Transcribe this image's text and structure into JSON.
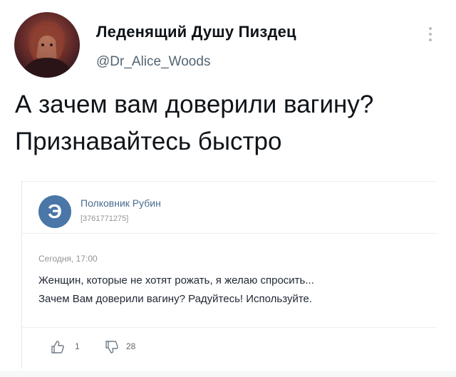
{
  "tweet": {
    "display_name": "Леденящий Душу Пиздец",
    "handle": "@Dr_Alice_Woods",
    "text_lines": [
      "А зачем вам доверили вагину?",
      "Признавайтесь быстро"
    ]
  },
  "embedded_post": {
    "avatar_letter": "Э",
    "author": "Полковник Рубин",
    "id": "[3761771275]",
    "date": "Сегодня, 17:00",
    "text_lines": [
      "Женщин, которые не хотят рожать, я желаю спросить...",
      "Зачем Вам доверили вагину? Радуйтесь! Используйте."
    ],
    "likes": "1",
    "dislikes": "28"
  },
  "icons": {
    "more": "more-vertical-icon",
    "like": "thumbs-up-icon",
    "dislike": "thumbs-down-icon"
  },
  "colors": {
    "text": "#0f1419",
    "secondary": "#536471",
    "vk_blue": "#4a76a8"
  }
}
